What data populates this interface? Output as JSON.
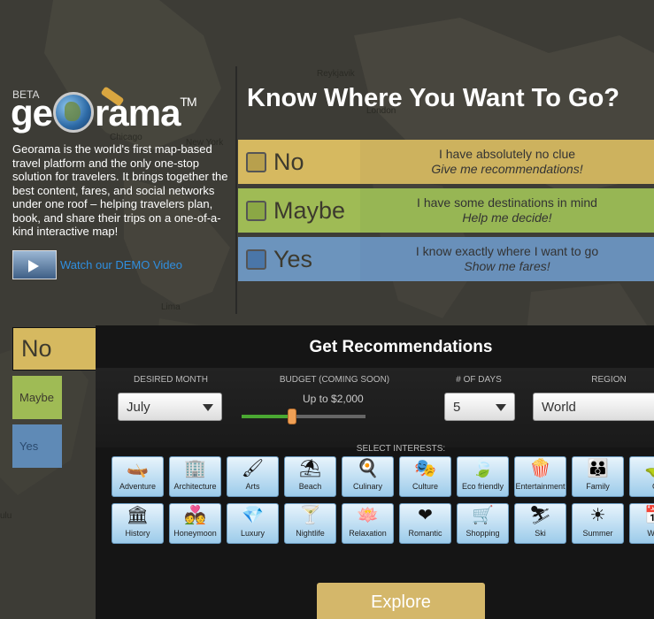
{
  "map": {
    "labels": [
      "Reykjavik",
      "London",
      "Chicago",
      "New York",
      "Lima",
      "ulu"
    ]
  },
  "intro": {
    "beta": "BETA",
    "logo_pre": "ge",
    "logo_post": "rama",
    "logo_tm": "TM",
    "description": "Georama is the world's first map-based travel platform and the only one-stop solution for travelers. It brings together the best content, fares, and social networks under one roof – helping travelers plan, book, and share their trips on a one-of-a-kind interactive map!",
    "demo_link": "Watch our DEMO Video"
  },
  "headline": "Know Where You Want To Go?",
  "options": {
    "no": {
      "label": "No",
      "line1": "I have absolutely no clue",
      "line2": "Give me recommendations!"
    },
    "maybe": {
      "label": "Maybe",
      "line1": "I have some destinations in mind",
      "line2": "Help me decide!"
    },
    "yes": {
      "label": "Yes",
      "line1": "I know exactly where I want to go",
      "line2": "Show me fares!"
    }
  },
  "tabs": {
    "no": "No",
    "maybe": "Maybe",
    "yes": "Yes"
  },
  "panel": {
    "title": "Get Recommendations",
    "filters": {
      "month_label": "DESIRED MONTH",
      "month_value": "July",
      "budget_label": "BUDGET (COMING SOON)",
      "budget_value": "Up to $2,000",
      "budget_fraction": 0.41,
      "days_label": "# OF DAYS",
      "days_value": "5",
      "region_label": "REGION",
      "region_value": "World"
    },
    "interests_label": "SELECT INTERESTS:",
    "interests_row1": [
      {
        "label": "Adventure",
        "icon": "kayak-icon",
        "glyph": "🛶"
      },
      {
        "label": "Architecture",
        "icon": "buildings-icon",
        "glyph": "🏢"
      },
      {
        "label": "Arts",
        "icon": "brush-icon",
        "glyph": "🖌"
      },
      {
        "label": "Beach",
        "icon": "umbrella-icon",
        "glyph": "⛱"
      },
      {
        "label": "Culinary",
        "icon": "chef-hat-icon",
        "glyph": "🍳"
      },
      {
        "label": "Culture",
        "icon": "mask-icon",
        "glyph": "🎭"
      },
      {
        "label": "Eco friendly",
        "icon": "leaf-icon",
        "glyph": "🍃"
      },
      {
        "label": "Entertainment",
        "icon": "popcorn-icon",
        "glyph": "🍿"
      },
      {
        "label": "Family",
        "icon": "family-icon",
        "glyph": "👪"
      },
      {
        "label": "G",
        "icon": "golf-icon",
        "glyph": "⛳"
      }
    ],
    "interests_row2": [
      {
        "label": "History",
        "icon": "colosseum-icon",
        "glyph": "🏛"
      },
      {
        "label": "Honeymoon",
        "icon": "couple-heart-icon",
        "glyph": "💑"
      },
      {
        "label": "Luxury",
        "icon": "diamond-icon",
        "glyph": "💎"
      },
      {
        "label": "Nightlife",
        "icon": "cocktail-icon",
        "glyph": "🍸"
      },
      {
        "label": "Relaxation",
        "icon": "lotus-icon",
        "glyph": "🪷"
      },
      {
        "label": "Romantic",
        "icon": "heart-icon",
        "glyph": "❤"
      },
      {
        "label": "Shopping",
        "icon": "cart-icon",
        "glyph": "🛒"
      },
      {
        "label": "Ski",
        "icon": "skier-icon",
        "glyph": "⛷"
      },
      {
        "label": "Summer",
        "icon": "sun-icon",
        "glyph": "☀"
      },
      {
        "label": "Wee",
        "icon": "calendar-icon",
        "glyph": "📅"
      }
    ],
    "explore": "Explore"
  },
  "colors": {
    "no": "#d6b960",
    "maybe": "#9fbb55",
    "yes": "#6c94bd",
    "panel": "#151515",
    "explore": "#d4b76a"
  }
}
